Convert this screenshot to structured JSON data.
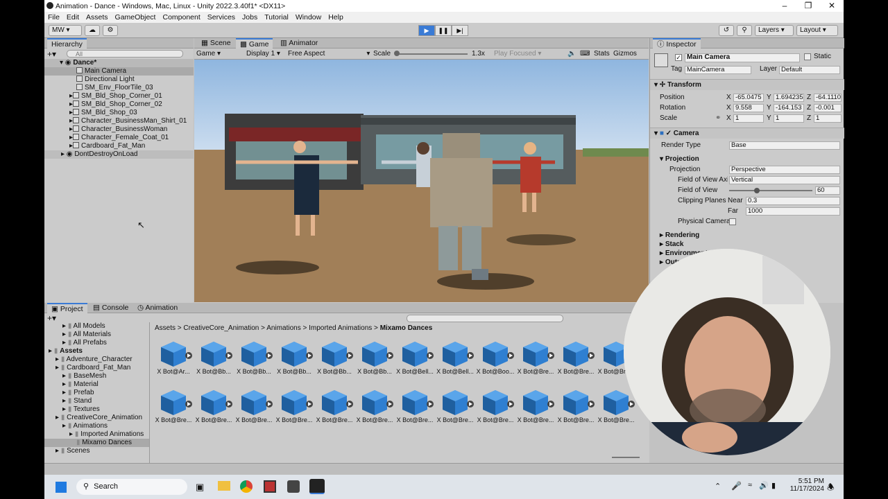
{
  "window": {
    "title": "Animation - Dance - Windows, Mac, Linux - Unity 2022.3.40f1* <DX11>"
  },
  "menu": [
    "File",
    "Edit",
    "Assets",
    "GameObject",
    "Component",
    "Services",
    "Jobs",
    "Tutorial",
    "Window",
    "Help"
  ],
  "toolbar": {
    "account": "MW",
    "layers": "Layers",
    "layout": "Layout"
  },
  "hierarchy": {
    "tab": "Hierarchy",
    "search_placeholder": "All",
    "scene": "Dance*",
    "items": [
      "Main Camera",
      "Directional Light",
      "SM_Env_FloorTile_03",
      "SM_Bld_Shop_Corner_01",
      "SM_Bld_Shop_Corner_02",
      "SM_Bld_Shop_03",
      "Character_BusinessMan_Shirt_01",
      "Character_BusinessWoman",
      "Character_Female_Coat_01",
      "Cardboard_Fat_Man"
    ],
    "dont_destroy": "DontDestroyOnLoad"
  },
  "view_tabs": [
    "Scene",
    "Game",
    "Animator"
  ],
  "game_toolbar": {
    "mode": "Game",
    "display": "Display 1",
    "aspect": "Free Aspect",
    "scale_label": "Scale",
    "scale_value": "1.3x",
    "play_focused": "Play Focused",
    "stats": "Stats",
    "gizmos": "Gizmos"
  },
  "inspector": {
    "tab": "Inspector",
    "object_name": "Main Camera",
    "static_label": "Static",
    "tag_label": "Tag",
    "tag_value": "MainCamera",
    "layer_label": "Layer",
    "layer_value": "Default",
    "transform": {
      "title": "Transform",
      "position_label": "Position",
      "position": [
        "-65.0475",
        "1.694235",
        "-64.1110"
      ],
      "rotation_label": "Rotation",
      "rotation": [
        "9.558",
        "-164.153",
        "-0.001"
      ],
      "scale_label": "Scale",
      "scale": [
        "1",
        "1",
        "1"
      ]
    },
    "camera": {
      "title": "Camera",
      "render_type_label": "Render Type",
      "render_type": "Base",
      "projection_header": "Projection",
      "projection_label": "Projection",
      "projection": "Perspective",
      "fov_axis_label": "Field of View Axis",
      "fov_axis": "Vertical",
      "fov_label": "Field of View",
      "fov": "60",
      "clipping_label": "Clipping Planes",
      "near_label": "Near",
      "near": "0.3",
      "far_label": "Far",
      "far": "1000",
      "physical_label": "Physical Camera"
    },
    "sections": [
      "Rendering",
      "Stack",
      "Environment",
      "Output"
    ]
  },
  "bottom_tabs": [
    "Project",
    "Console",
    "Animation"
  ],
  "project": {
    "tree": [
      {
        "label": "All Models",
        "indent": 2
      },
      {
        "label": "All Materials",
        "indent": 2
      },
      {
        "label": "All Prefabs",
        "indent": 2
      },
      {
        "label": "Assets",
        "indent": 0,
        "bold": true
      },
      {
        "label": "Adventure_Character",
        "indent": 1
      },
      {
        "label": "Cardboard_Fat_Man",
        "indent": 1
      },
      {
        "label": "BaseMesh",
        "indent": 2
      },
      {
        "label": "Material",
        "indent": 2
      },
      {
        "label": "Prefab",
        "indent": 2
      },
      {
        "label": "Stand",
        "indent": 2
      },
      {
        "label": "Textures",
        "indent": 2
      },
      {
        "label": "CreativeCore_Animation",
        "indent": 1
      },
      {
        "label": "Animations",
        "indent": 2
      },
      {
        "label": "Imported Animations",
        "indent": 3
      },
      {
        "label": "Mixamo Dances",
        "indent": 4,
        "selected": true
      },
      {
        "label": "Scenes",
        "indent": 1
      }
    ],
    "breadcrumb": [
      "Assets",
      "CreativeCore_Animation",
      "Animations",
      "Imported Animations",
      "Mixamo Dances"
    ],
    "row1": [
      "X Bot@Ar...",
      "X Bot@Bb...",
      "X Bot@Bb...",
      "X Bot@Bb...",
      "X Bot@Bb...",
      "X Bot@Bb...",
      "X Bot@Bell...",
      "X Bot@Bell...",
      "X Bot@Boo...",
      "X Bot@Bre...",
      "X Bot@Bre...",
      "X Bot@Bre..."
    ],
    "row2": [
      "X Bot@Bre...",
      "X Bot@Bre...",
      "X Bot@Bre...",
      "X Bot@Bre...",
      "X Bot@Bre...",
      "X Bot@Bre...",
      "X Bot@Bre...",
      "X Bot@Bre...",
      "X Bot@Bre...",
      "X Bot@Bre...",
      "X Bot@Bre...",
      "X Bot@Bre..."
    ]
  },
  "taskbar": {
    "search": "Search",
    "time": "5:51 PM",
    "date": "11/17/2024"
  },
  "colors": {
    "accent": "#3a7bd5",
    "asset_blue": "#2f7fd1"
  }
}
